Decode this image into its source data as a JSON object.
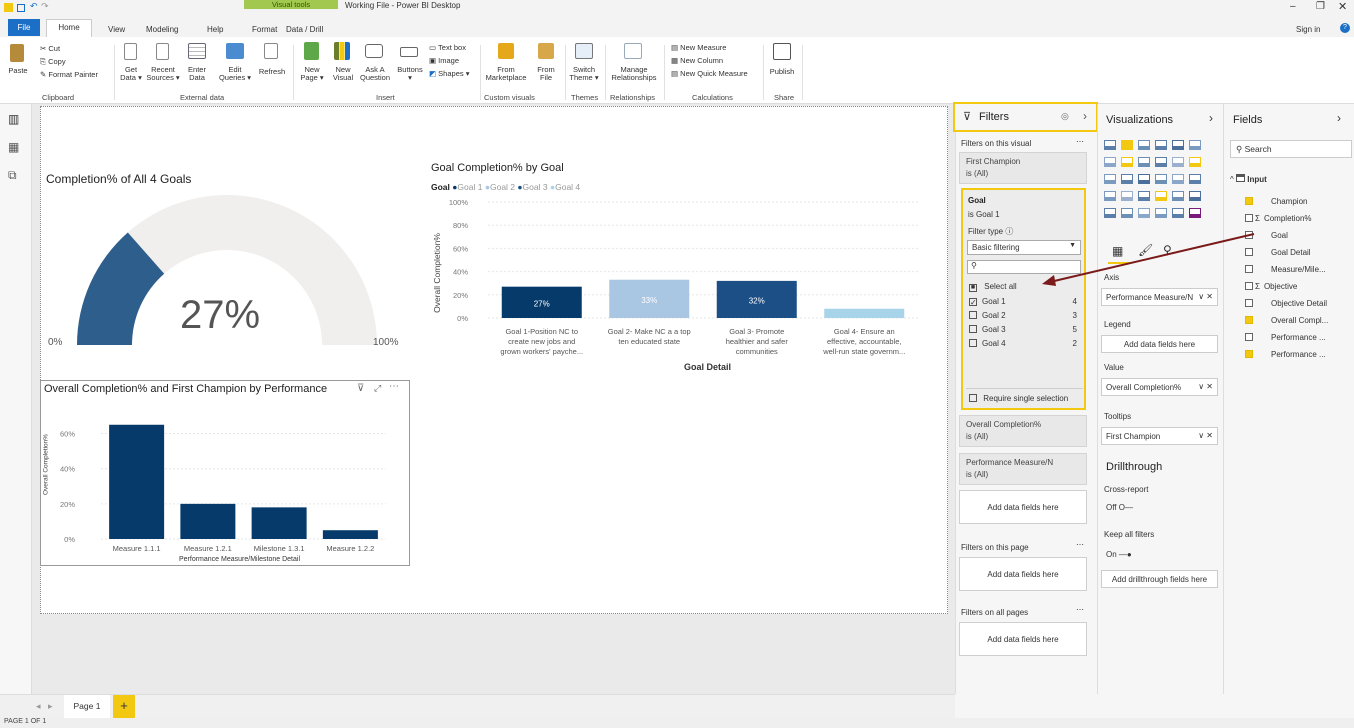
{
  "window": {
    "title": "Working File - Power BI Desktop",
    "context_group": "Visual tools",
    "sign_in": "Sign in"
  },
  "tabs": [
    "File",
    "Home",
    "View",
    "Modeling",
    "Help",
    "Format",
    "Data / Drill"
  ],
  "ribbon": {
    "clipboard": {
      "paste": "Paste",
      "cut": "Cut",
      "copy": "Copy",
      "format_painter": "Format Painter",
      "group": "Clipboard"
    },
    "external": {
      "get": "Get\nData ▾",
      "recent": "Recent\nSources ▾",
      "enter": "Enter\nData",
      "edit": "Edit\nQueries ▾",
      "refresh": "Refresh",
      "group": "External data"
    },
    "insert": {
      "new_page": "New\nPage ▾",
      "new_visual": "New\nVisual",
      "ask": "Ask A\nQuestion",
      "buttons": "Buttons\n▾",
      "textbox": "Text box",
      "image": "Image",
      "shapes": "Shapes ▾",
      "group": "Insert"
    },
    "custom": {
      "market": "From\nMarketplace",
      "file": "From\nFile",
      "group": "Custom visuals"
    },
    "themes": {
      "switch": "Switch\nTheme ▾",
      "group": "Themes"
    },
    "rel": {
      "manage": "Manage\nRelationships",
      "group": "Relationships"
    },
    "calc": {
      "measure": "New Measure",
      "column": "New Column",
      "quick": "New Quick Measure",
      "group": "Calculations"
    },
    "share": {
      "publish": "Publish",
      "group": "Share"
    }
  },
  "gauge": {
    "title": "Completion% of All 4 Goals",
    "value": "27%",
    "min": "0%",
    "max": "100%",
    "fraction": 0.27
  },
  "goal_chart": {
    "title": "Goal Completion% by Goal",
    "legend_title": "Goal",
    "legend": [
      "Goal 1",
      "Goal 2",
      "Goal 3",
      "Goal 4"
    ],
    "ylabel": "Overall Completion%",
    "xlabel": "Goal Detail",
    "yticks": [
      "100%",
      "80%",
      "60%",
      "40%",
      "20%",
      "0%"
    ],
    "cats": [
      [
        "Goal 1-Position NC to",
        "create new jobs and",
        "grown workers' payche..."
      ],
      [
        "Goal 2- Make NC a a top",
        "ten educated state"
      ],
      [
        "Goal 3- Promote",
        "healthier and safer",
        "communities"
      ],
      [
        "Goal 4- Ensure an",
        "effective, accountable,",
        "well-run state governm..."
      ]
    ],
    "labels": [
      "27%",
      "33%",
      "32%",
      ""
    ]
  },
  "perf_chart": {
    "title": "Overall Completion% and First Champion by Performance",
    "ylabel": "Overall Completion%",
    "xlabel": "Performance Measure/Milestone Detail",
    "yticks": [
      "60%",
      "40%",
      "20%",
      "0%"
    ],
    "cats": [
      "Measure 1.1.1",
      "Measure 1.2.1",
      "Milestone 1.3.1",
      "Measure 1.2.2"
    ]
  },
  "chart_data": [
    {
      "type": "bar",
      "title": "Goal Completion% by Goal",
      "categories": [
        "Goal 1",
        "Goal 2",
        "Goal 3",
        "Goal 4"
      ],
      "values": [
        27,
        33,
        32,
        8
      ],
      "ylim": [
        0,
        100
      ],
      "ylabel": "Overall Completion%",
      "xlabel": "Goal Detail",
      "colors": [
        "#063a6b",
        "#a9c6e3",
        "#1c4f86",
        "#a8d4ea"
      ]
    },
    {
      "type": "bar",
      "title": "Overall Completion% and First Champion by Performance",
      "categories": [
        "Measure 1.1.1",
        "Measure 1.2.1",
        "Milestone 1.3.1",
        "Measure 1.2.2"
      ],
      "values": [
        65,
        20,
        18,
        5
      ],
      "ylim": [
        0,
        65
      ],
      "ylabel": "Overall Completion%",
      "xlabel": "Performance Measure/Milestone Detail",
      "colors": [
        "#063a6b"
      ]
    }
  ],
  "filters": {
    "title": "Filters",
    "on_visual": "Filters on this visual",
    "card1": [
      "First Champion",
      "is (All)"
    ],
    "goal_title": "Goal",
    "goal_sub": "is Goal 1",
    "filter_type": "Filter type",
    "filter_type_value": "Basic filtering",
    "select_all": "Select all",
    "items": [
      {
        "label": "Goal 1",
        "count": "4",
        "checked": true
      },
      {
        "label": "Goal 2",
        "count": "3"
      },
      {
        "label": "Goal 3",
        "count": "5"
      },
      {
        "label": "Goal 4",
        "count": "2"
      }
    ],
    "require_single": "Require single selection",
    "card2": [
      "Overall Completion%",
      "is (All)"
    ],
    "card3": [
      "Performance Measure/N",
      "is (All)"
    ],
    "add": "Add data fields here",
    "on_page": "Filters on this page",
    "on_all": "Filters on all pages"
  },
  "viz": {
    "title": "Visualizations",
    "axis": "Axis",
    "axis_val": "Performance Measure/N",
    "legend": "Legend",
    "legend_add": "Add data fields here",
    "value": "Value",
    "value_val": "Overall Completion%",
    "tooltips": "Tooltips",
    "tooltips_val": "First Champion",
    "drill": "Drillthrough",
    "cross": "Cross-report",
    "off": "Off",
    "keep": "Keep all filters",
    "on": "On",
    "add_drill": "Add drillthrough fields here"
  },
  "fields": {
    "title": "Fields",
    "search": "Search",
    "table": "Input",
    "items": [
      {
        "label": "Champion",
        "checked": true
      },
      {
        "label": "Completion%",
        "sigma": true
      },
      {
        "label": "Goal"
      },
      {
        "label": "Goal Detail"
      },
      {
        "label": "Measure/Mile..."
      },
      {
        "label": "Objective",
        "sigma": true
      },
      {
        "label": "Objective Detail"
      },
      {
        "label": "Overall Compl...",
        "checked": true
      },
      {
        "label": "Performance ..."
      },
      {
        "label": "Performance ...",
        "checked": true
      }
    ]
  },
  "pages": {
    "tab": "Page 1",
    "add": "+"
  },
  "status": "PAGE 1 OF 1"
}
